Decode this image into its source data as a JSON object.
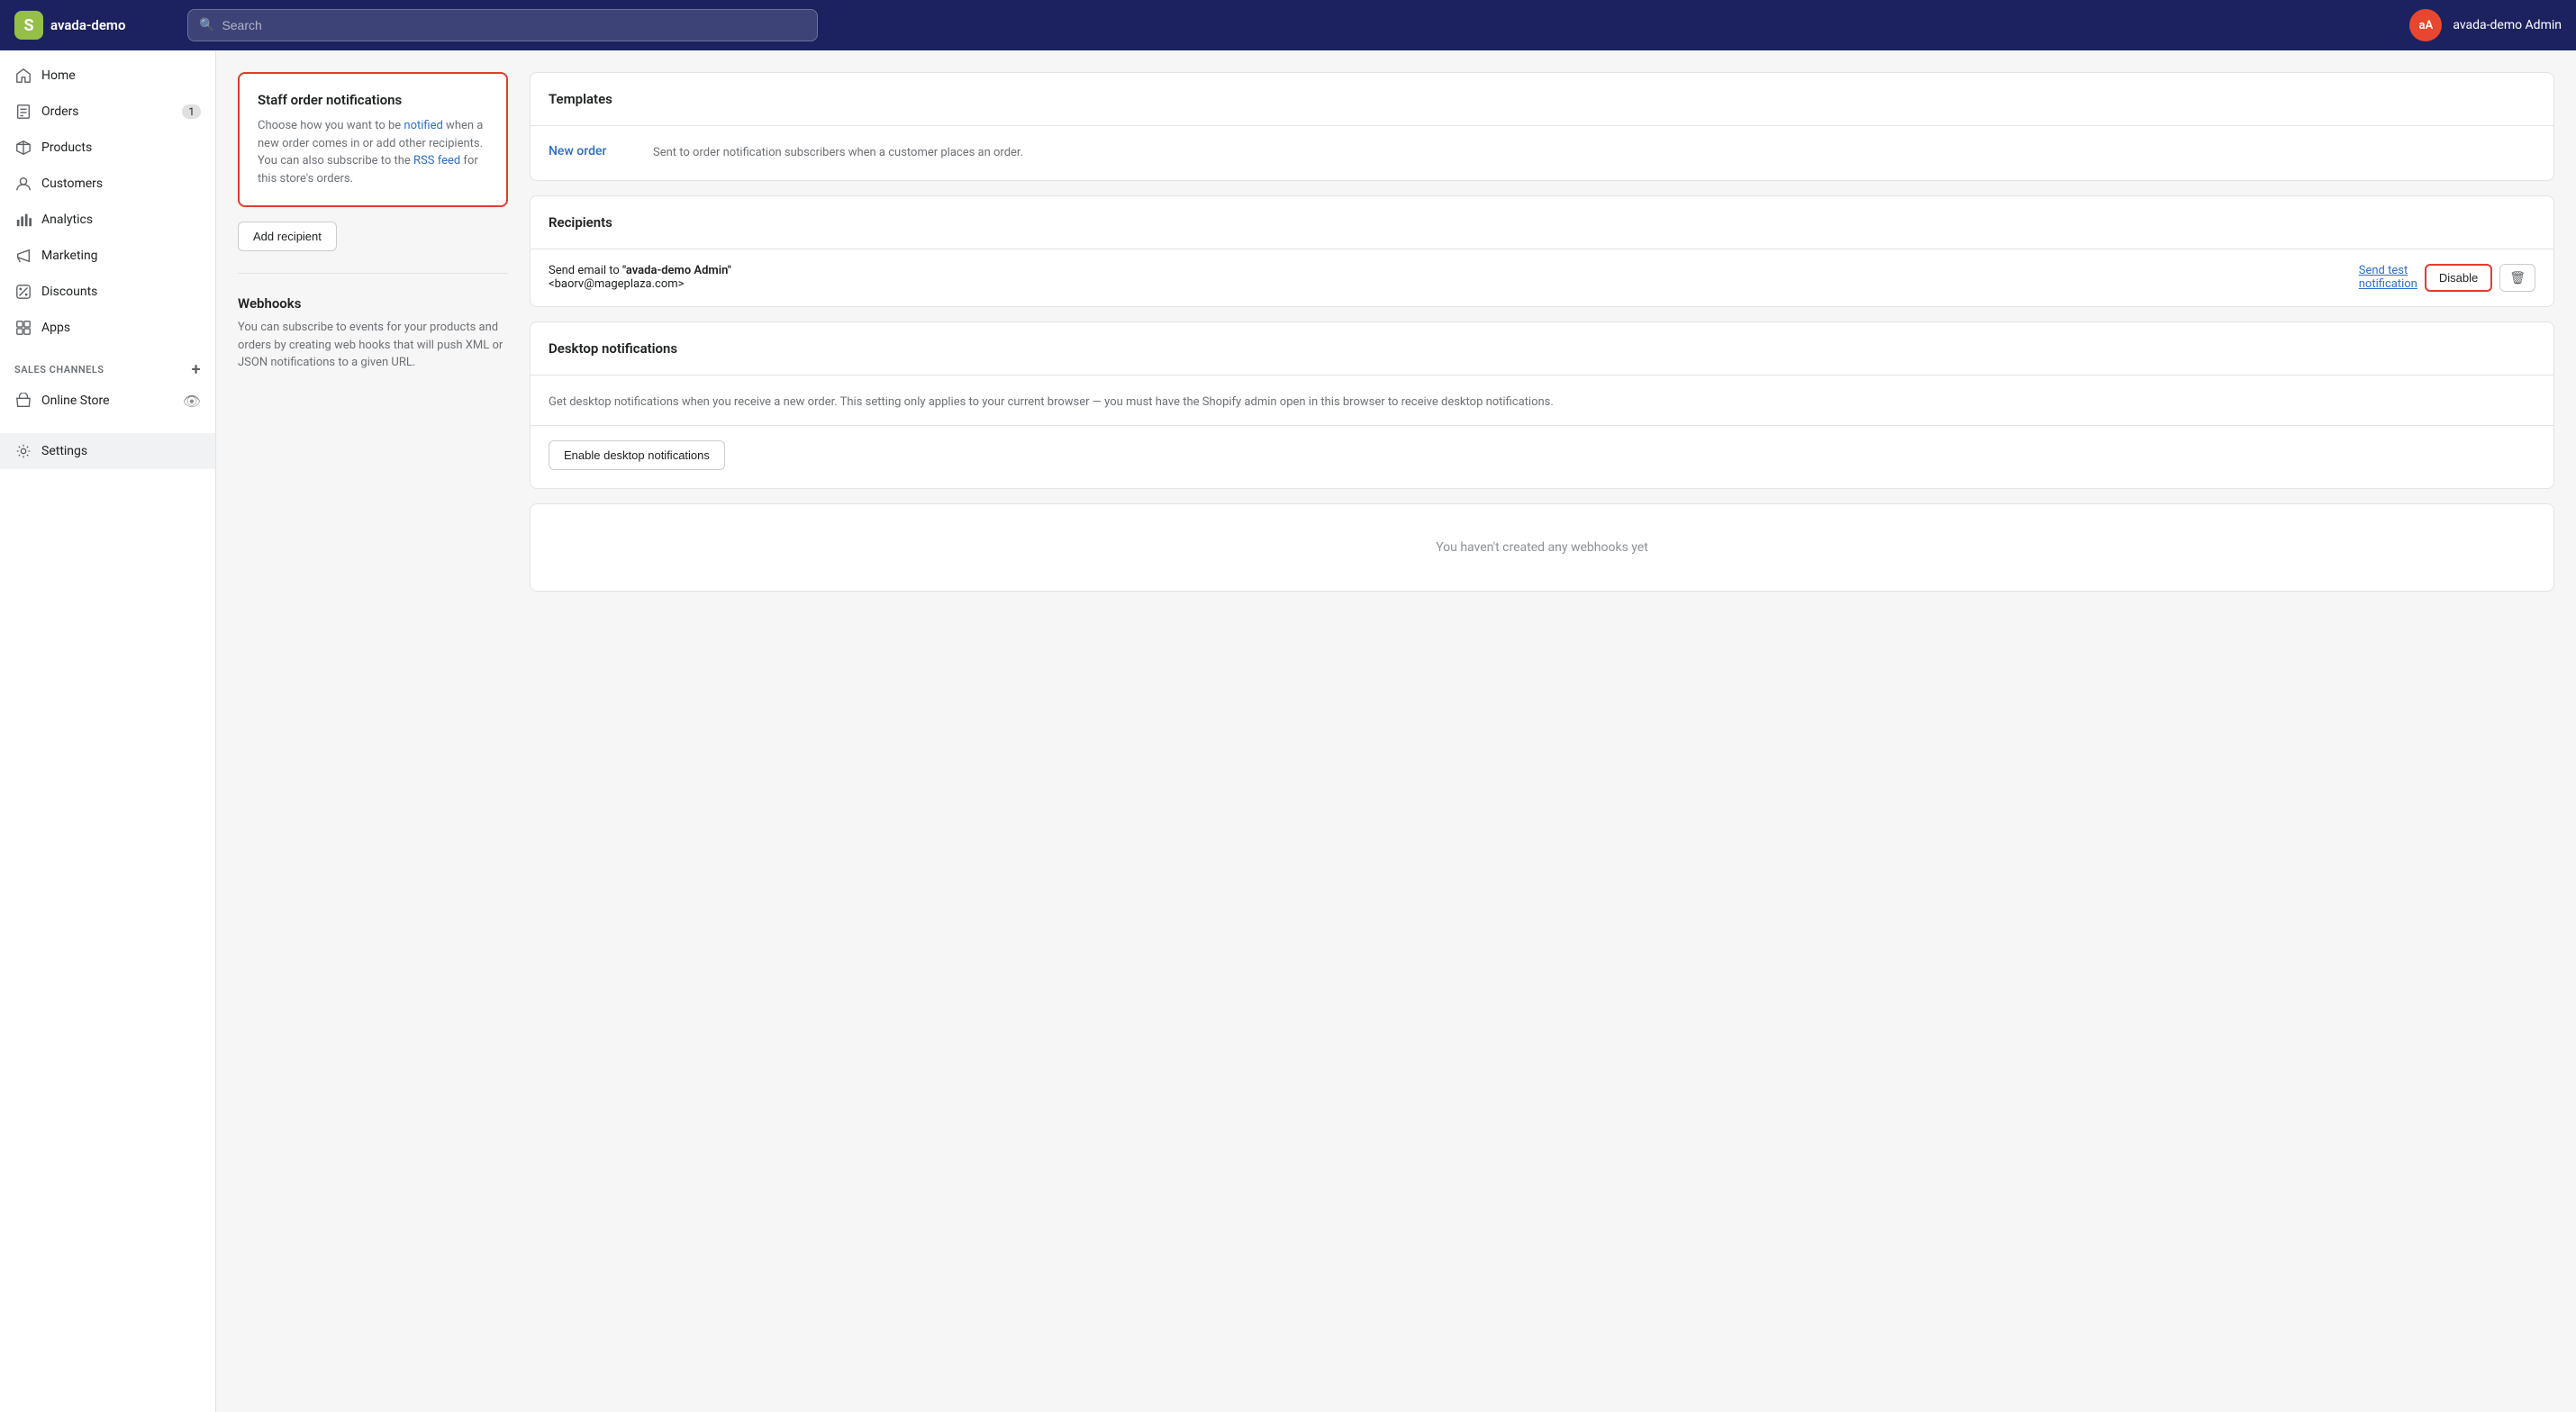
{
  "header": {
    "logo_text": "avada-demo",
    "search_placeholder": "Search",
    "admin_initials": "aA",
    "admin_name": "avada-demo Admin"
  },
  "sidebar": {
    "items": [
      {
        "id": "home",
        "label": "Home",
        "icon": "home"
      },
      {
        "id": "orders",
        "label": "Orders",
        "icon": "orders",
        "badge": "1"
      },
      {
        "id": "products",
        "label": "Products",
        "icon": "products"
      },
      {
        "id": "customers",
        "label": "Customers",
        "icon": "customers"
      },
      {
        "id": "analytics",
        "label": "Analytics",
        "icon": "analytics"
      },
      {
        "id": "marketing",
        "label": "Marketing",
        "icon": "marketing"
      },
      {
        "id": "discounts",
        "label": "Discounts",
        "icon": "discounts"
      },
      {
        "id": "apps",
        "label": "Apps",
        "icon": "apps"
      }
    ],
    "sales_channels_label": "SALES CHANNELS",
    "sales_channels": [
      {
        "id": "online-store",
        "label": "Online Store",
        "icon": "store"
      }
    ],
    "settings_label": "Settings",
    "settings_id": "settings"
  },
  "left_panel": {
    "staff_order_title": "Staff order notifications",
    "staff_order_desc_before": "Choose how you want to be ",
    "staff_order_notified_link": "notified",
    "staff_order_desc_middle": " when a new order comes in or add other recipients. You can also subscribe to the ",
    "staff_order_rss_link": "RSS feed",
    "staff_order_desc_after": " for this store's orders.",
    "add_recipient_btn": "Add recipient",
    "webhooks_title": "Webhooks",
    "webhooks_desc": "You can subscribe to events for your products and orders by creating web hooks that will push XML or JSON notifications to a given URL."
  },
  "right_panel": {
    "templates_title": "Templates",
    "templates": [
      {
        "link_text": "New order",
        "description": "Sent to order notification subscribers when a customer places an order."
      }
    ],
    "recipients_title": "Recipients",
    "recipients": [
      {
        "send_to_prefix": "Send email to ",
        "name": "\"avada-demo Admin\"",
        "email": "<baorv@mageplaza.com>",
        "send_test_label": "Send test",
        "notification_suffix": "notification",
        "disable_label": "Disable"
      }
    ],
    "desktop_notif_title": "Desktop notifications",
    "desktop_notif_desc": "Get desktop notifications when you receive a new order. This setting only applies to your current browser — you must have the Shopify admin open in this browser to receive desktop notifications.",
    "enable_desktop_btn": "Enable desktop notifications",
    "webhooks_empty": "You haven't created any webhooks yet"
  }
}
